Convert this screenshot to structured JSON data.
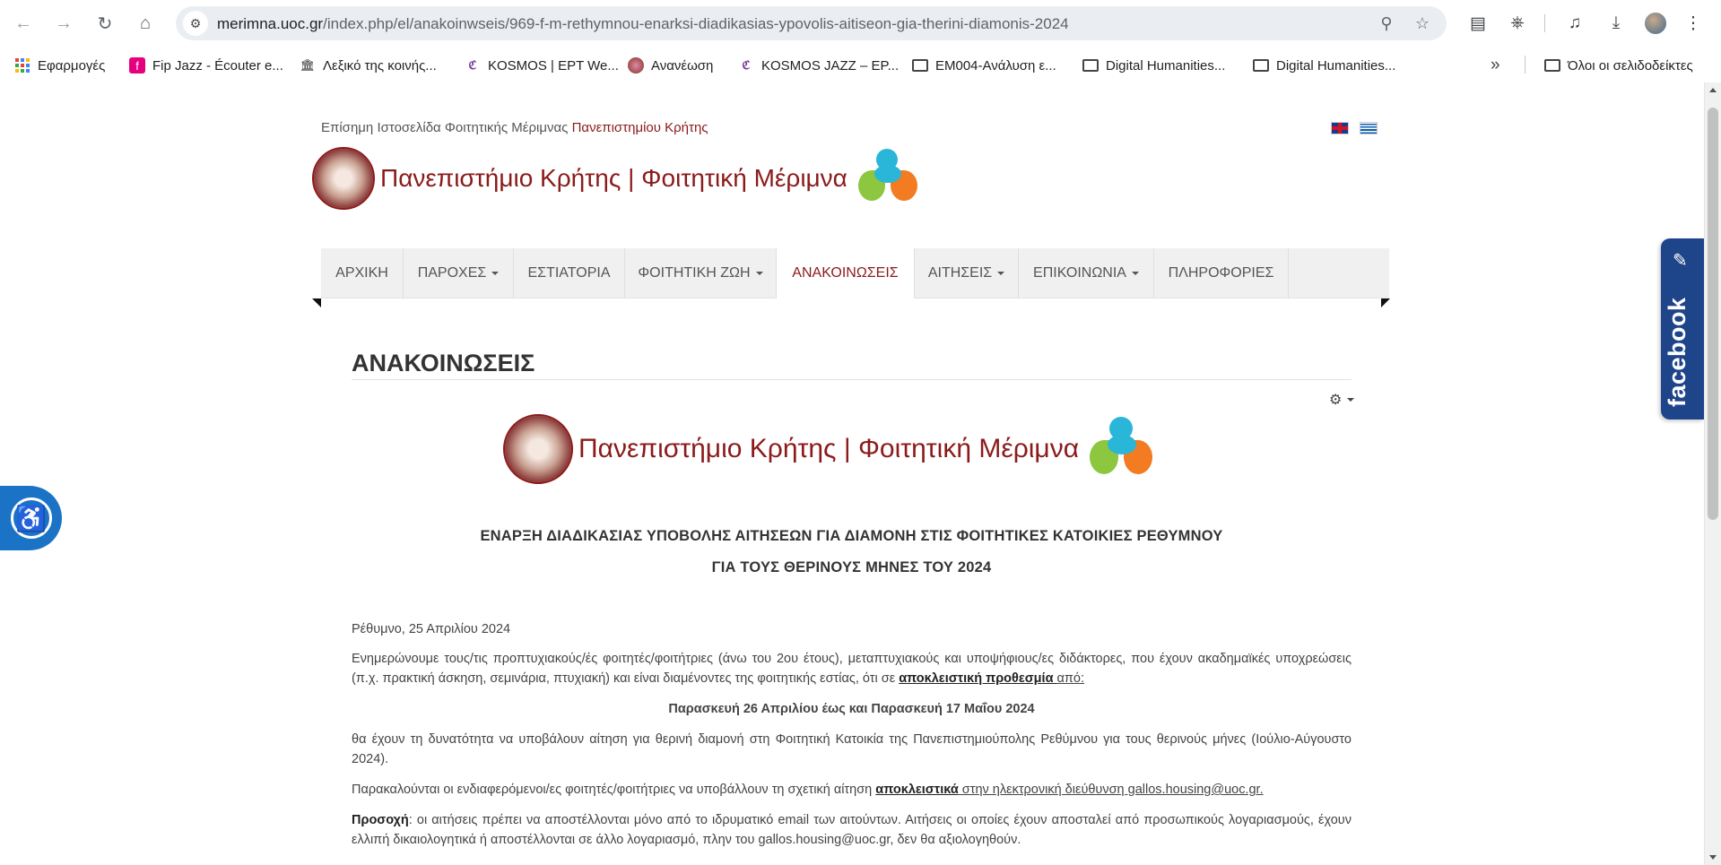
{
  "browser": {
    "url_host": "merimna.uoc.gr",
    "url_path": "/index.php/el/anakoinwseis/969-f-m-rethymnou-enarksi-diadikasias-ypovolis-aitiseon-gia-therini-diamonis-2024",
    "bookmarks": [
      {
        "label": "Εφαρμογές",
        "icon": "apps-grid-icon"
      },
      {
        "label": "Fip Jazz - Écouter e...",
        "icon": "fip-icon"
      },
      {
        "label": "Λεξικό της κοινής...",
        "icon": "lexicon-icon"
      },
      {
        "label": "KOSMOS | ΕΡΤ We...",
        "icon": "kosmos-icon"
      },
      {
        "label": "Ανανέωση",
        "icon": "ananeosi-icon"
      },
      {
        "label": "KOSMOS JAZZ – ΕΡ...",
        "icon": "kosmos-icon"
      },
      {
        "label": "EM004-Ανάλυση ε...",
        "icon": "folder-icon"
      },
      {
        "label": "Digital Humanities...",
        "icon": "folder-icon"
      },
      {
        "label": "Digital Humanities...",
        "icon": "folder-icon"
      }
    ],
    "bookmarks_overflow": "»",
    "all_bookmarks": "Όλοι οι σελιδοδείκτες"
  },
  "header": {
    "tagline_prefix": "Επίσημη Ιστοσελίδα Φοιτητικής Μέριμνας ",
    "tagline_uni": "Πανεπιστημίου Κρήτης",
    "logo_text": "Πανεπιστήμιο Κρήτης | Φοιτητική Μέριμνα",
    "mascot_text": "Φοιτητική Μέριμνα"
  },
  "nav": [
    {
      "label": "ΑΡΧΙΚΗ",
      "dropdown": false
    },
    {
      "label": "ΠΑΡΟΧΕΣ",
      "dropdown": true
    },
    {
      "label": "ΕΣΤΙΑΤΟΡΙΑ",
      "dropdown": false
    },
    {
      "label": "ΦΟΙΤΗΤΙΚΗ ΖΩΗ",
      "dropdown": true
    },
    {
      "label": "ΑΝΑΚΟΙΝΩΣΕΙΣ",
      "dropdown": false,
      "active": true
    },
    {
      "label": "ΑΙΤΗΣΕΙΣ",
      "dropdown": true
    },
    {
      "label": "ΕΠΙΚΟΙΝΩΝΙΑ",
      "dropdown": true
    },
    {
      "label": "ΠΛΗΡΟΦΟΡΙΕΣ",
      "dropdown": false
    }
  ],
  "article": {
    "section_title": "ΑΝΑΚΟΙΝΩΣΕΙΣ",
    "headline_1": "ΕΝΑΡΞΗ ΔΙΑΔΙΚΑΣΙΑΣ ΥΠΟΒΟΛΗΣ ΑΙΤΗΣΕΩΝ ΓΙΑ ΔΙΑΜΟΝΗ ΣΤΙΣ ΦΟΙΤΗΤΙΚΕΣ ΚΑΤΟΙΚΙΕΣ ΡΕΘΥΜΝΟΥ",
    "headline_2": "ΓΙΑ ΤΟΥΣ ΘΕΡΙΝΟΥΣ ΜΗΝΕΣ ΤΟΥ 2024",
    "date": "Ρέθυμνο, 25 Απριλίου 2024",
    "p1_text": "Ενημερώνουμε τους/τις προπτυχιακούς/ές φοιτητές/φοιτήτριες (άνω του 2ου έτους), μεταπτυχιακούς και υποψήφιους/ες διδάκτορες, που έχουν ακαδημαϊκές υποχρεώσεις (π.χ. πρακτική άσκηση, σεμινάρια, πτυχιακή) και είναι διαμένοντες της φοιτητικής εστίας, ότι σε ",
    "p1_bold": "αποκλειστική προθεσμία ",
    "p1_end": "από:",
    "deadline": "Παρασκευή 26 Απριλίου έως και Παρασκευή 17 Μαΐου 2024",
    "p2": "θα έχουν τη δυνατότητα να υποβάλουν αίτηση για θερινή διαμονή στη Φοιτητική Κατοικία της Πανεπιστημιούπολης Ρεθύμνου για τους θερινούς μήνες (Ιούλιο-Αύγουστο 2024).",
    "p3_text": "Παρακαλούνται οι ενδιαφερόμενοι/ες φοιτητές/φοιτήτριες να υποβάλλουν τη σχετική αίτηση ",
    "p3_bold": "αποκλειστικά",
    "p3_link": " στην ηλεκτρονική διεύθυνση gallos.housing@uoc.gr.",
    "p4_label": "Προσοχή",
    "p4_text": ": οι αιτήσεις πρέπει να αποστέλλονται μόνο από το ιδρυματικό email των αιτούντων. Αιτήσεις οι οποίες έχουν αποσταλεί  από προσωπικούς λογαριασμούς, έχουν ελλιπή δικαιολογητικά ή αποστέλλονται σε άλλο λογαριασμό, πλην του gallos.housing@uoc.gr, δεν θα αξιολογηθούν."
  },
  "widgets": {
    "facebook_label": "facebook"
  },
  "colors": {
    "brand_red": "#8b1a1a",
    "facebook_blue": "#1e4489",
    "accessibility_blue": "#1a73c5",
    "nav_bg": "#f0f0f0"
  }
}
